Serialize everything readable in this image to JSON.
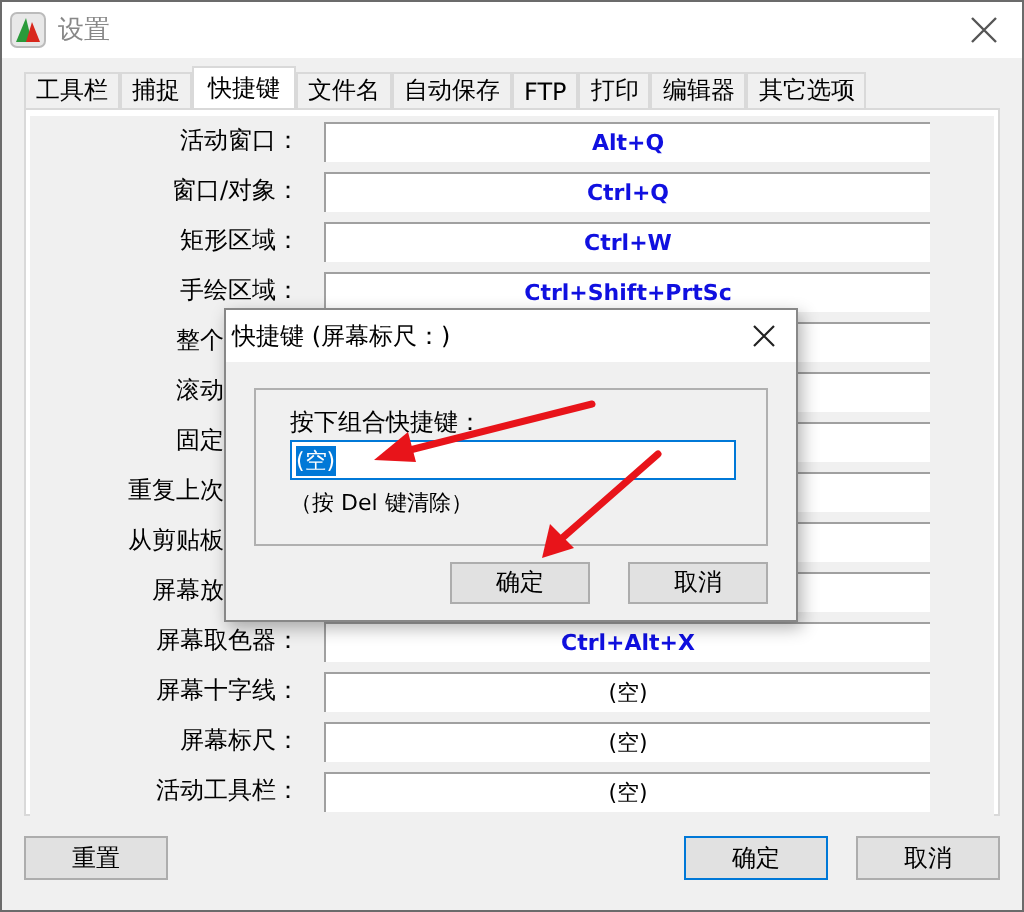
{
  "window": {
    "title": "设置"
  },
  "tabs": [
    {
      "label": "工具栏",
      "selected": false
    },
    {
      "label": "捕捉",
      "selected": false
    },
    {
      "label": "快捷键",
      "selected": true
    },
    {
      "label": "文件名",
      "selected": false
    },
    {
      "label": "自动保存",
      "selected": false
    },
    {
      "label": "FTP",
      "selected": false
    },
    {
      "label": "打印",
      "selected": false
    },
    {
      "label": "编辑器",
      "selected": false
    },
    {
      "label": "其它选项",
      "selected": false
    }
  ],
  "shortcuts": [
    {
      "label": "活动窗口：",
      "kind": "key",
      "value": "Alt+Q"
    },
    {
      "label": "窗口/对象：",
      "kind": "key",
      "value": "Ctrl+Q"
    },
    {
      "label": "矩形区域：",
      "kind": "key",
      "value": "Ctrl+W"
    },
    {
      "label": "手绘区域：",
      "kind": "key",
      "value": "Ctrl+Shift+PrtSc"
    },
    {
      "label": "整个"
    },
    {
      "label": "滚动"
    },
    {
      "label": "固定"
    },
    {
      "label": "重复上次"
    },
    {
      "label": "从剪贴板"
    },
    {
      "label": "屏幕放"
    },
    {
      "label": "屏幕取色器：",
      "kind": "key",
      "value": "Ctrl+Alt+X"
    },
    {
      "label": "屏幕十字线：",
      "kind": "empty",
      "value": "(空)"
    },
    {
      "label": "屏幕标尺：",
      "kind": "empty",
      "value": "(空)"
    },
    {
      "label": "活动工具栏：",
      "kind": "empty",
      "value": "(空)"
    }
  ],
  "buttons": {
    "reset": "重置",
    "ok": "确定",
    "cancel": "取消"
  },
  "dialog": {
    "title": "快捷键 (屏幕标尺：)",
    "prompt": "按下组合快捷键：",
    "input": {
      "value": "(空)",
      "text_selected": true
    },
    "hint": "（按 Del 键清除）",
    "buttons": {
      "ok": "确定",
      "cancel": "取消"
    }
  }
}
